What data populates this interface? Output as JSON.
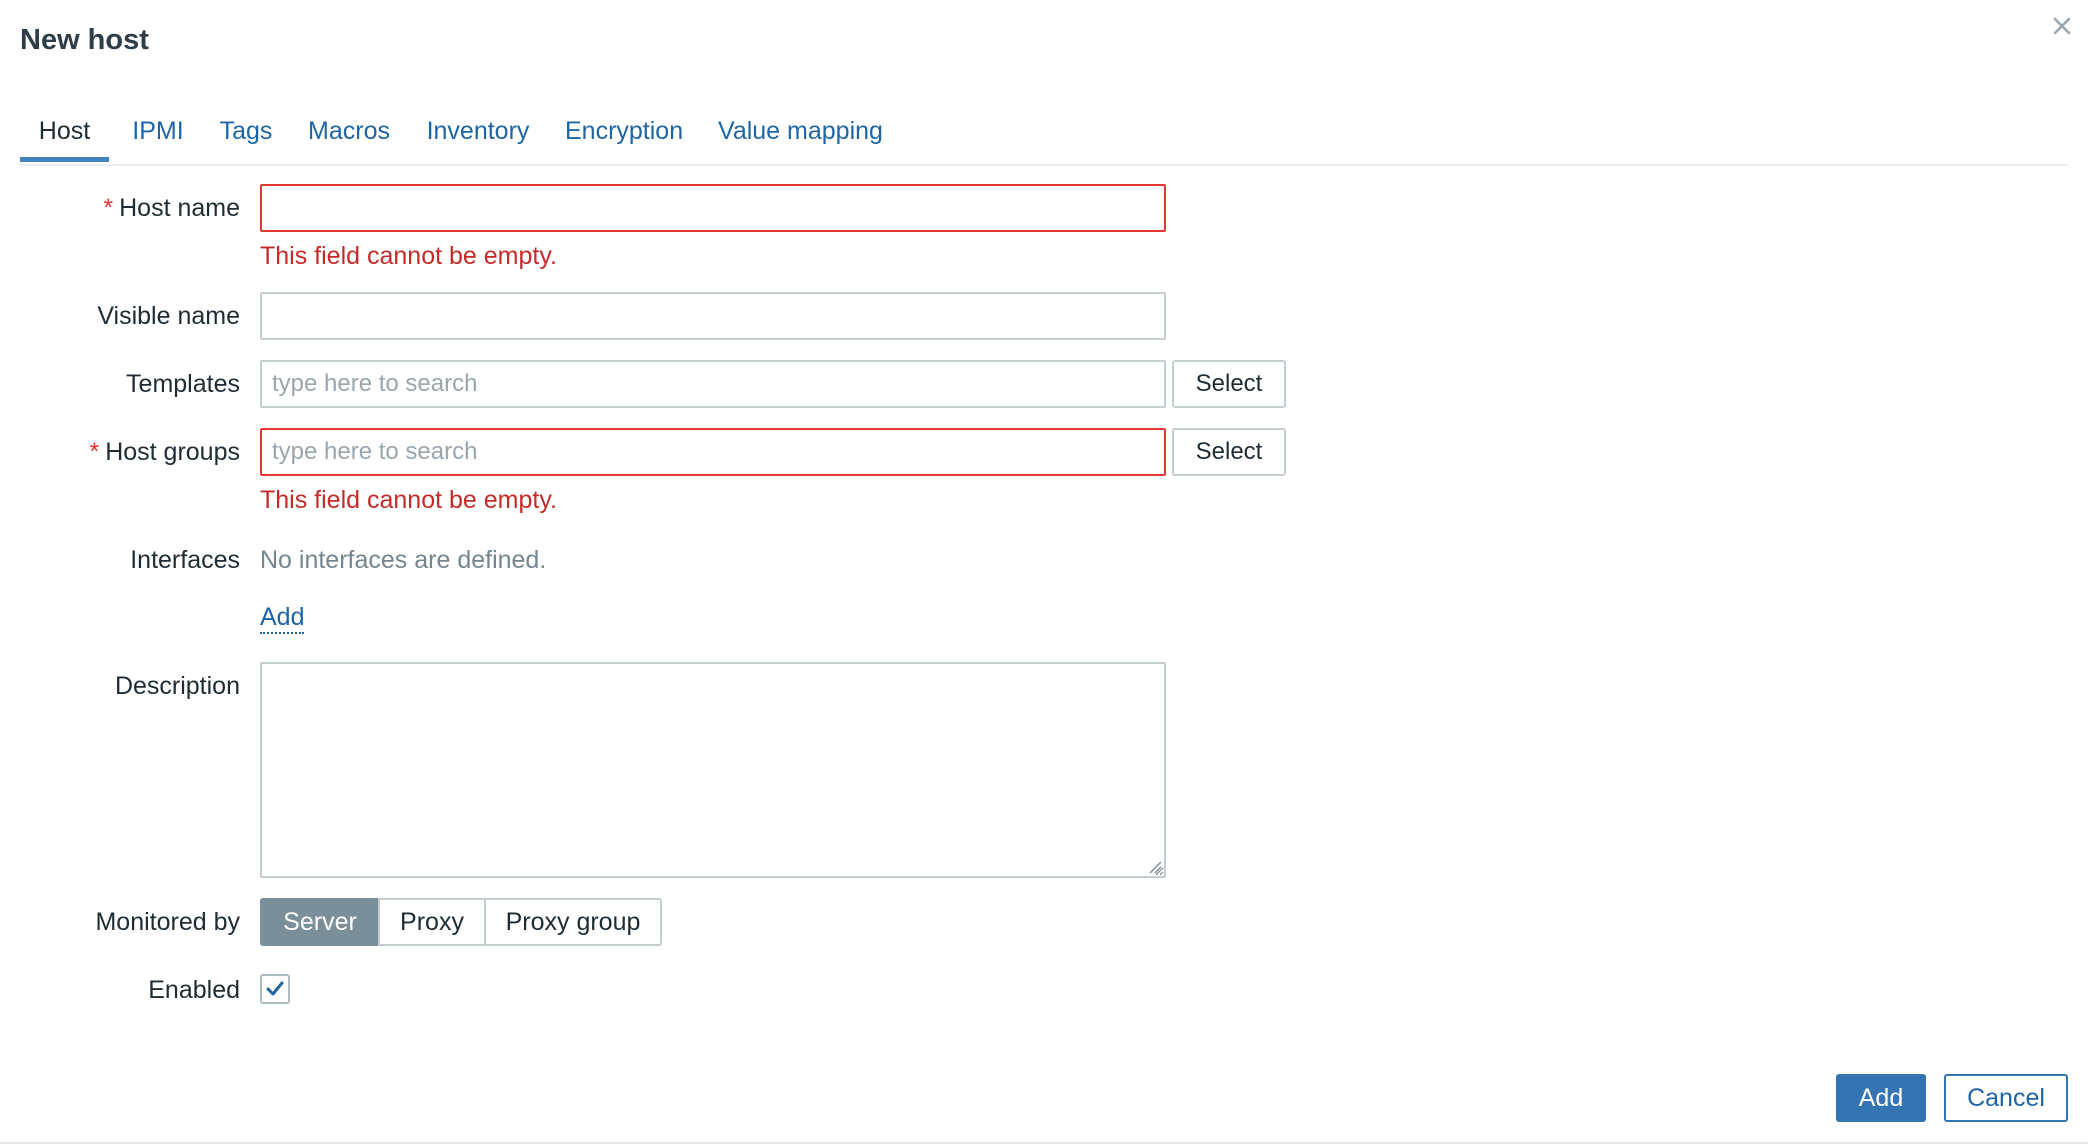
{
  "dialog": {
    "title": "New host",
    "close_icon": "close-icon"
  },
  "tabs": [
    {
      "label": "Host",
      "active": true
    },
    {
      "label": "IPMI",
      "active": false
    },
    {
      "label": "Tags",
      "active": false
    },
    {
      "label": "Macros",
      "active": false
    },
    {
      "label": "Inventory",
      "active": false
    },
    {
      "label": "Encryption",
      "active": false
    },
    {
      "label": "Value mapping",
      "active": false
    }
  ],
  "form": {
    "required_mark": "*",
    "host_name": {
      "label": "Host name",
      "value": "",
      "error": "This field cannot be empty."
    },
    "visible_name": {
      "label": "Visible name",
      "value": ""
    },
    "templates": {
      "label": "Templates",
      "placeholder": "type here to search",
      "select_label": "Select"
    },
    "host_groups": {
      "label": "Host groups",
      "placeholder": "type here to search",
      "select_label": "Select",
      "error": "This field cannot be empty."
    },
    "interfaces": {
      "label": "Interfaces",
      "empty_text": "No interfaces are defined.",
      "add_label": "Add"
    },
    "description": {
      "label": "Description",
      "value": ""
    },
    "monitored_by": {
      "label": "Monitored by",
      "options": [
        "Server",
        "Proxy",
        "Proxy group"
      ],
      "selected": "Server"
    },
    "enabled": {
      "label": "Enabled",
      "checked": true
    }
  },
  "footer": {
    "add_label": "Add",
    "cancel_label": "Cancel"
  },
  "colors": {
    "link": "#1f65a6",
    "error": "#c42c29",
    "required": "#e33734",
    "primary_button": "#3574b3",
    "segment_selected": "#7b8f9b",
    "tab_underline": "#4082c2"
  }
}
